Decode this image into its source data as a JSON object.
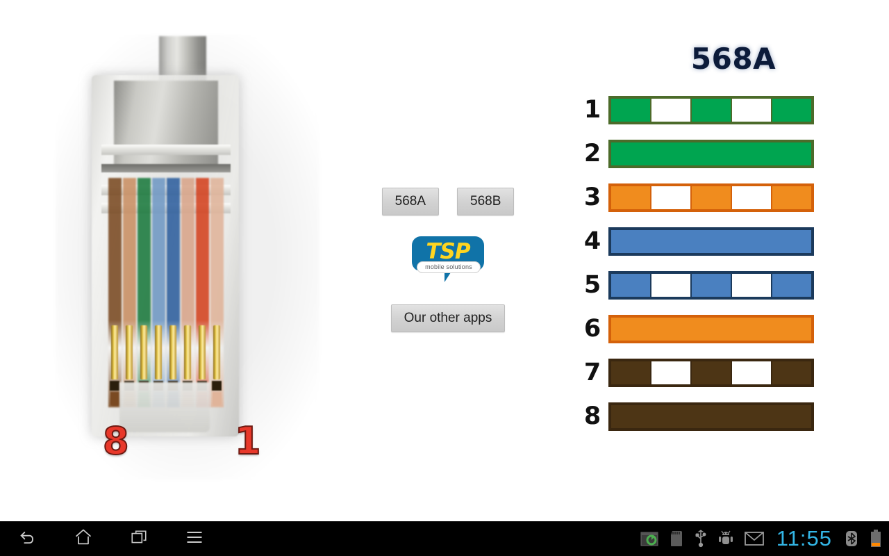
{
  "app": {
    "connector": {
      "photo_alt": "rj45-connector-photo",
      "pin_label_left": "8",
      "pin_label_right": "1",
      "wire_colors_left_to_right": [
        "#7a4a22",
        "#c98f63",
        "#1b7a3e",
        "#6f98c4",
        "#2e5f9e",
        "#d9a58a",
        "#d4421f",
        "#e0b49a"
      ]
    },
    "controls": {
      "standard_a_button": "568A",
      "standard_b_button": "568B",
      "other_apps_button": "Our other apps",
      "logo": {
        "name": "TSP",
        "tagline": "mobile solutions",
        "bubble_color": "#1073a8",
        "text_color": "#ffd520"
      }
    },
    "diagram": {
      "title": "568A",
      "title_color": "#0c1b3a",
      "rows": [
        {
          "pin": "1",
          "pair_name": "white-green",
          "fill": "#00a550",
          "border": "#4c6b2a",
          "striped": true
        },
        {
          "pin": "2",
          "pair_name": "green",
          "fill": "#00a550",
          "border": "#4c6b2a",
          "striped": false
        },
        {
          "pin": "3",
          "pair_name": "white-orange",
          "fill": "#f08c1e",
          "border": "#d4610a",
          "striped": true
        },
        {
          "pin": "4",
          "pair_name": "blue",
          "fill": "#4a80c0",
          "border": "#1b3a5c",
          "striped": false
        },
        {
          "pin": "5",
          "pair_name": "white-blue",
          "fill": "#4a80c0",
          "border": "#1b3a5c",
          "striped": true
        },
        {
          "pin": "6",
          "pair_name": "orange",
          "fill": "#f08c1e",
          "border": "#d4610a",
          "striped": false
        },
        {
          "pin": "7",
          "pair_name": "white-brown",
          "fill": "#4d3515",
          "border": "#3a2710",
          "striped": true
        },
        {
          "pin": "8",
          "pair_name": "brown",
          "fill": "#4d3515",
          "border": "#3a2710",
          "striped": false
        }
      ]
    }
  },
  "system_bar": {
    "nav_keys": [
      {
        "name": "back",
        "icon": "back-arrow-icon"
      },
      {
        "name": "home",
        "icon": "home-icon"
      },
      {
        "name": "recents",
        "icon": "recent-apps-icon"
      },
      {
        "name": "menu",
        "icon": "menu-icon"
      }
    ],
    "status_icons": [
      {
        "name": "sync",
        "icon": "sync-icon"
      },
      {
        "name": "sd-card",
        "icon": "sd-card-icon"
      },
      {
        "name": "usb",
        "icon": "usb-icon"
      },
      {
        "name": "usb-debugging",
        "icon": "android-debug-icon"
      },
      {
        "name": "email",
        "icon": "gmail-icon"
      }
    ],
    "clock": "11:55",
    "clock_color": "#33b5e5",
    "bluetooth_icon": "bluetooth-icon",
    "battery_icon": "battery-low-icon",
    "battery_level_color": "#ff8800"
  }
}
